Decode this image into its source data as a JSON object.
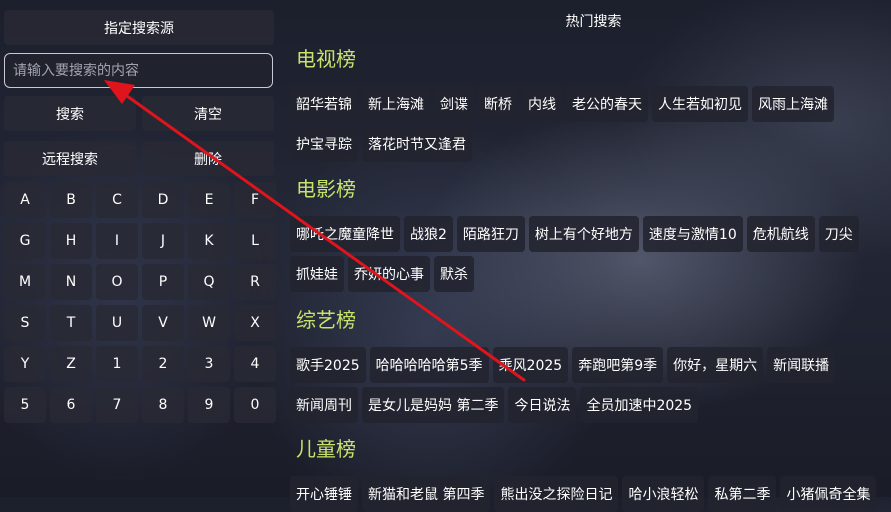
{
  "left_panel": {
    "source_button": "指定搜索源",
    "search_placeholder": "请输入要搜索的内容",
    "search_button": "搜索",
    "clear_button": "清空",
    "remote_search_button": "远程搜索",
    "delete_button": "删除",
    "keys": [
      "A",
      "B",
      "C",
      "D",
      "E",
      "F",
      "G",
      "H",
      "I",
      "J",
      "K",
      "L",
      "M",
      "N",
      "O",
      "P",
      "Q",
      "R",
      "S",
      "T",
      "U",
      "V",
      "W",
      "X",
      "Y",
      "Z",
      "1",
      "2",
      "3",
      "4",
      "5",
      "6",
      "7",
      "8",
      "9",
      "0"
    ]
  },
  "right_panel": {
    "title": "热门搜索",
    "sections": [
      {
        "title": "电视榜",
        "items": [
          "韶华若锦",
          "新上海滩",
          "剑谍",
          "断桥",
          "内线",
          "老公的春天",
          "人生若如初见",
          "风雨上海滩",
          "护宝寻踪",
          "落花时节又逢君"
        ]
      },
      {
        "title": "电影榜",
        "items": [
          "哪吒之魔童降世",
          "战狼2",
          "陌路狂刀",
          "树上有个好地方",
          "速度与激情10",
          "危机航线",
          "刀尖",
          "抓娃娃",
          "乔妍的心事",
          "默杀"
        ]
      },
      {
        "title": "综艺榜",
        "items": [
          "歌手2025",
          "哈哈哈哈哈第5季",
          "乘风2025",
          "奔跑吧第9季",
          "你好，星期六",
          "新闻联播",
          "新闻周刊",
          "是女儿是妈妈 第二季",
          "今日说法",
          "全员加速中2025"
        ]
      },
      {
        "title": "儿童榜",
        "items": [
          "开心锤锤",
          "新猫和老鼠 第四季",
          "熊出没之探险日记",
          "哈小浪轻松",
          "私第二季",
          "小猪佩奇全集"
        ]
      }
    ]
  },
  "colors": {
    "section_title": "#c7e36b",
    "arrow": "#e0141c"
  },
  "icons": {
    "annotation": "red-arrow-icon"
  }
}
